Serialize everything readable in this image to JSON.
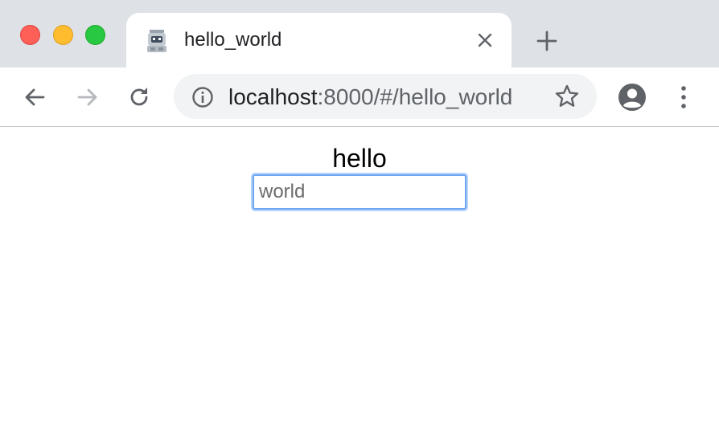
{
  "window": {
    "traffic_lights": [
      "close",
      "minimize",
      "zoom"
    ]
  },
  "tab": {
    "title": "hello_world",
    "favicon": "robot-favicon-icon"
  },
  "toolbar": {
    "url_host": "localhost",
    "url_rest": ":8000/#/hello_world"
  },
  "page": {
    "greeting": "hello",
    "input_value": "world"
  },
  "colors": {
    "tabstrip_bg": "#dee1e6",
    "omnibox_bg": "#f1f3f4",
    "focus_ring": "#6ea6f2"
  }
}
